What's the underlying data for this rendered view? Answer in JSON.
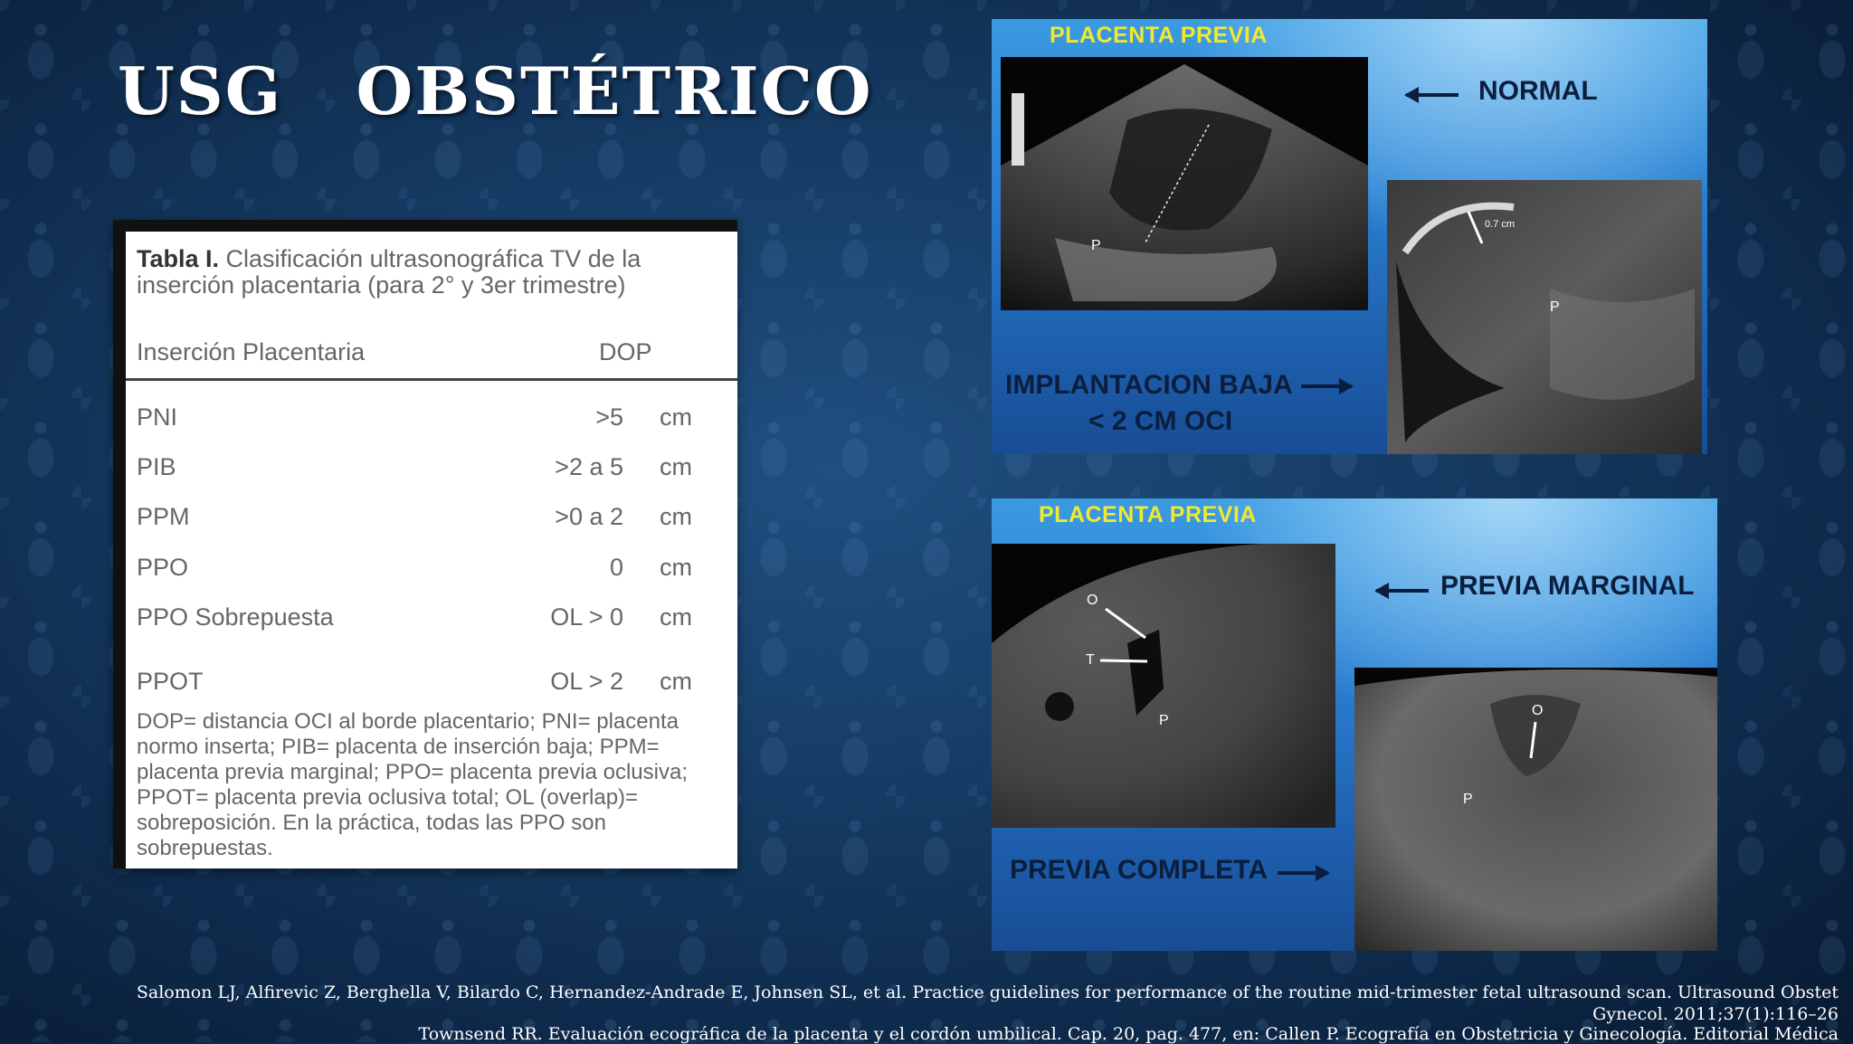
{
  "slide": {
    "title": "USG   OBSTÉTRICO"
  },
  "table": {
    "caption_bold": "Tabla I.",
    "caption_text": " Clasificación ultrasonográfica TV de la inserción placentaria (para 2° y 3er trimestre)",
    "col_header_1": "Inserción Placentaria",
    "col_header_2": "DOP",
    "rows": [
      {
        "name": "PNI",
        "value": ">5",
        "unit": "cm"
      },
      {
        "name": "PIB",
        "value": ">2 a 5",
        "unit": "cm"
      },
      {
        "name": "PPM",
        "value": ">0 a 2",
        "unit": "cm"
      },
      {
        "name": "PPO",
        "value": "0",
        "unit": "cm"
      },
      {
        "name": "PPO Sobrepuesta",
        "value": "OL > 0",
        "unit": "cm"
      },
      {
        "name": "PPOT",
        "value": "OL > 2",
        "unit": "cm"
      }
    ],
    "footnote": "DOP= distancia OCI al borde placentario; PNI= placenta normo inserta; PIB= placenta de inserción baja; PPM= placenta previa marginal; PPO= placenta previa oclusiva; PPOT= placenta previa oclusiva total; OL (overlap)= sobreposición. En la práctica, todas las PPO son sobrepuestas."
  },
  "panel_top": {
    "title": "PLACENTA PREVIA",
    "label_normal": "NORMAL",
    "label_low_1": "IMPLANTACION BAJA",
    "label_low_2": "< 2 CM OCI",
    "scan1_mark": "P",
    "scan2_mark": "P",
    "scan2_measure": "0.7 cm"
  },
  "panel_bottom": {
    "title": "PLACENTA PREVIA",
    "label_marginal": "PREVIA MARGINAL",
    "label_complete": "PREVIA COMPLETA",
    "scan1_marks": {
      "o": "O",
      "t": "T",
      "p": "P"
    },
    "scan2_marks": {
      "o": "O",
      "p": "P"
    }
  },
  "references": {
    "line1": "Salomon LJ, Alfirevic Z, Berghella V, Bilardo C, Hernandez-Andrade E, Johnsen SL, et al. Practice guidelines for performance of the routine mid-trimester fetal ultrasound scan. Ultrasound Obstet",
    "line2": "Gynecol. 2011;37(1):116–26",
    "line3": "Townsend RR. Evaluación ecográfica de la placenta y el cordón umbilical. Cap. 20, pag. 477, en: Callen P. Ecografía en Obstetricia y Ginecología. Editorial Médica"
  },
  "colors": {
    "panel_title": "#f2e830",
    "label_dark": "#0b1e3e",
    "slide_bg": "#173e68"
  }
}
